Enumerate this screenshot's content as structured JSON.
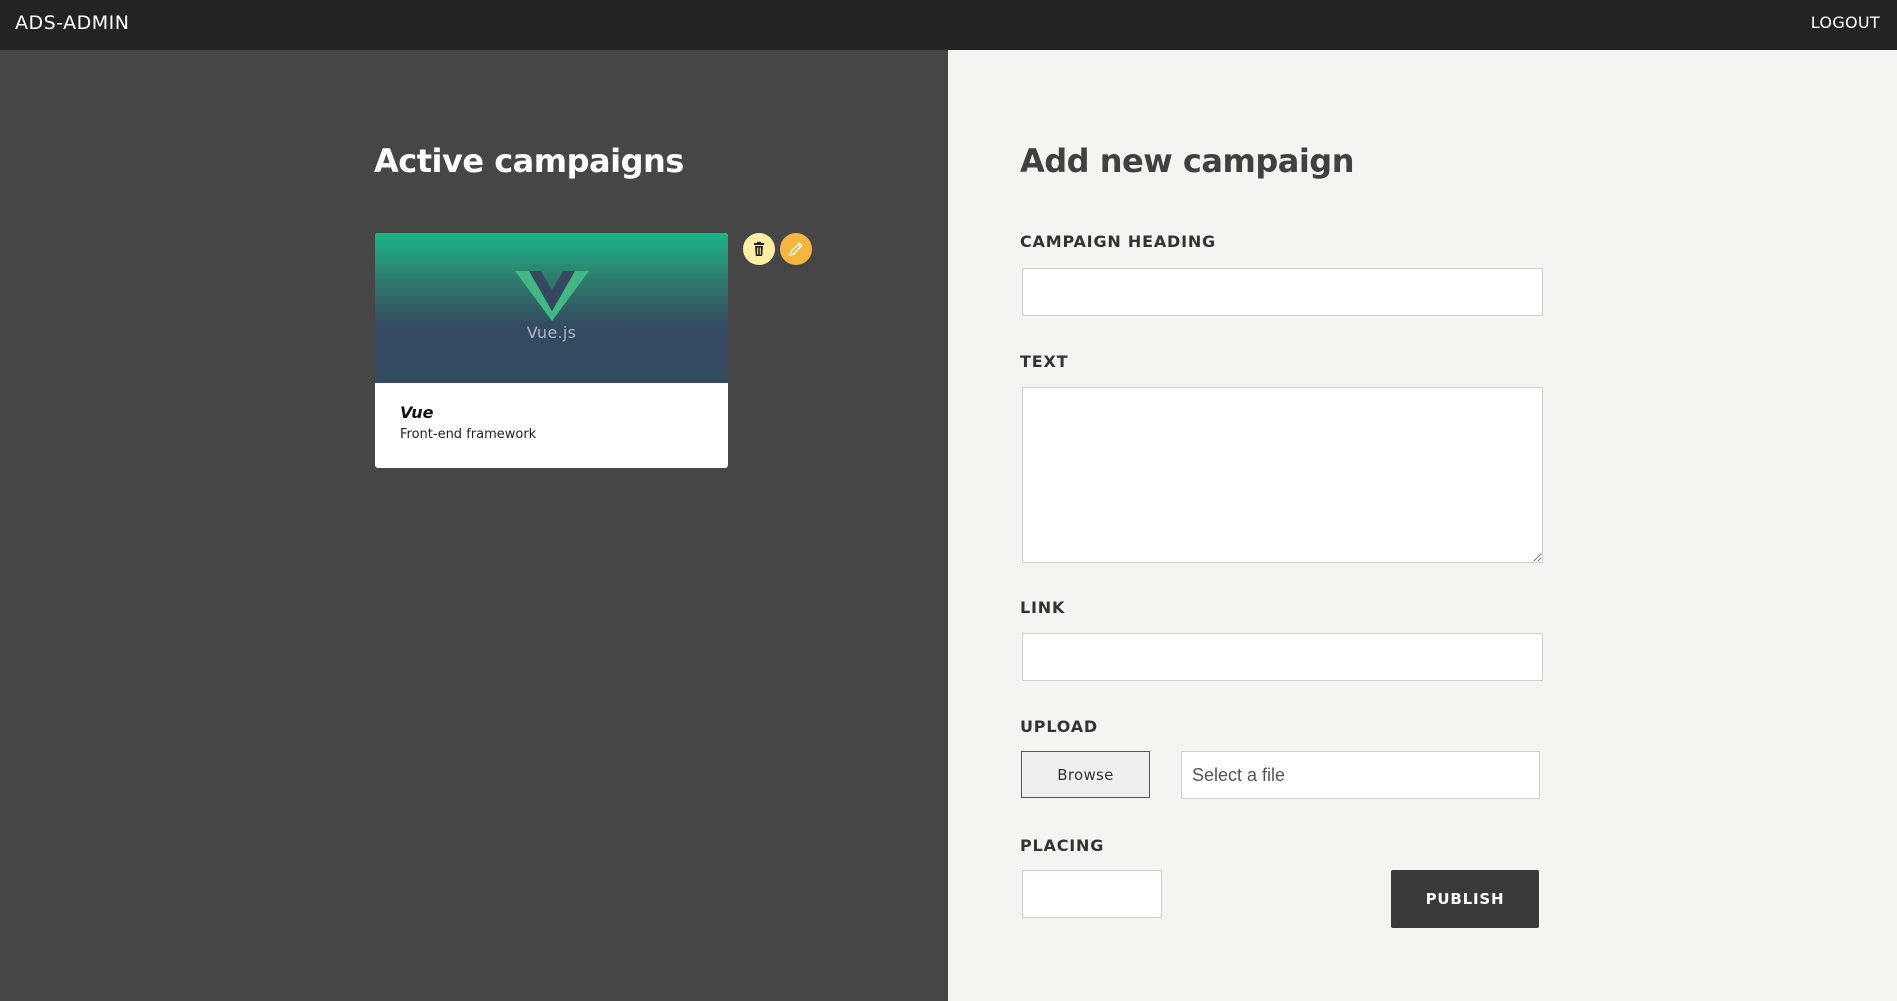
{
  "header": {
    "brand": "ADS-ADMIN",
    "logout_label": "LOGOUT"
  },
  "active_campaigns": {
    "title": "Active campaigns",
    "cards": [
      {
        "logo_text": "Vue.js",
        "title": "Vue",
        "subtitle": "Front-end framework"
      }
    ],
    "actions": {
      "delete_icon": "trash-icon",
      "edit_icon": "pencil-icon"
    }
  },
  "form": {
    "title": "Add new campaign",
    "heading_label": "CAMPAIGN HEADING",
    "heading_value": "",
    "text_label": "TEXT",
    "text_value": "",
    "link_label": "LINK",
    "link_value": "",
    "upload_label": "UPLOAD",
    "browse_label": "Browse",
    "file_placeholder": "Select a file",
    "placing_label": "PLACING",
    "placing_value": "",
    "publish_label": "PUBLISH"
  },
  "colors": {
    "topbar": "#232323",
    "left_bg": "#464646",
    "right_bg": "#f5f4f1",
    "vue_green": "#41b883",
    "vue_dark": "#35495e",
    "delete_btn": "#fbf0a1",
    "edit_btn": "#f6b63e",
    "publish_btn": "#3a3a3a"
  }
}
